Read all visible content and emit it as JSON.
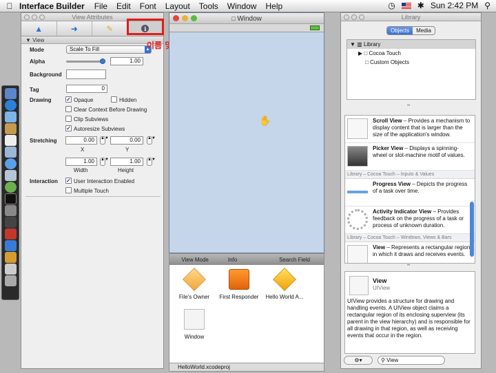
{
  "menubar": {
    "apple": "",
    "app_name": "Interface Builder",
    "items": [
      "File",
      "Edit",
      "Font",
      "Layout",
      "Tools",
      "Window",
      "Help"
    ],
    "clock": "Sun 2:42 PM"
  },
  "inspector": {
    "title": "View Attributes",
    "section": "View",
    "annotation": "이름 및 값 지정위해 클릭",
    "mode_label": "Mode",
    "mode_value": "Scale To Fill",
    "alpha_label": "Alpha",
    "alpha_value": "1.00",
    "background_label": "Background",
    "tag_label": "Tag",
    "tag_value": "0",
    "drawing_label": "Drawing",
    "opaque": "Opaque",
    "hidden": "Hidden",
    "clear_context": "Clear Context Before Drawing",
    "clip_subviews": "Clip Subviews",
    "autoresize": "Autoresize Subviews",
    "stretching_label": "Stretching",
    "stretch_x": "0.00",
    "stretch_y": "0.00",
    "x_label": "X",
    "y_label": "Y",
    "stretch_w": "1.00",
    "stretch_h": "1.00",
    "width_label": "Width",
    "height_label": "Height",
    "interaction_label": "Interaction",
    "user_interaction": "User Interaction Enabled",
    "multiple_touch": "Multiple Touch"
  },
  "window": {
    "title": "Window"
  },
  "document": {
    "toolbar": [
      "View Mode",
      "Info",
      "Search Field"
    ],
    "items": [
      {
        "label": "File's Owner"
      },
      {
        "label": "First Responder"
      },
      {
        "label": "Hello World A..."
      },
      {
        "label": "Window"
      }
    ],
    "status": "HelloWorld.xcodeproj"
  },
  "library": {
    "title": "Library",
    "tabs": [
      "Objects",
      "Media"
    ],
    "tree": [
      "Library",
      "Cocoa Touch",
      "Custom Objects"
    ],
    "list": [
      {
        "kind": "item",
        "name": "Scroll View",
        "text": " – Provides a mechanism to display content that is larger than the size of the application's window."
      },
      {
        "kind": "item",
        "name": "Picker View",
        "text": " – Displays a spinning-wheel or slot-machine motif of values."
      },
      {
        "kind": "cat",
        "text": "Library – Cocoa Touch – Inputs & Values"
      },
      {
        "kind": "item",
        "name": "Progress View",
        "text": " – Depicts the progress of a task over time."
      },
      {
        "kind": "item",
        "name": "Activity Indicator View",
        "text": " – Provides feedback on the progress of a task or process of unknown duration."
      },
      {
        "kind": "cat",
        "text": "Library – Cocoa Touch – Windows, Views & Bars"
      },
      {
        "kind": "item",
        "name": "View",
        "text": " – Represents a rectangular region in which it draws and receives events."
      }
    ],
    "detail_title": "View",
    "detail_class": "UIView",
    "detail_text": "UIView provides a structure for drawing and handling events. A UIView object claims a rectangular region of its enclosing superview (its parent in the view hierarchy) and is responsible for all drawing in that region, as well as receiving events that occur in the region.",
    "search_value": "View"
  },
  "colors": {
    "annotation": "#e31b1b",
    "accent": "#3b6fd1",
    "window_bg": "#c5d5ea"
  }
}
